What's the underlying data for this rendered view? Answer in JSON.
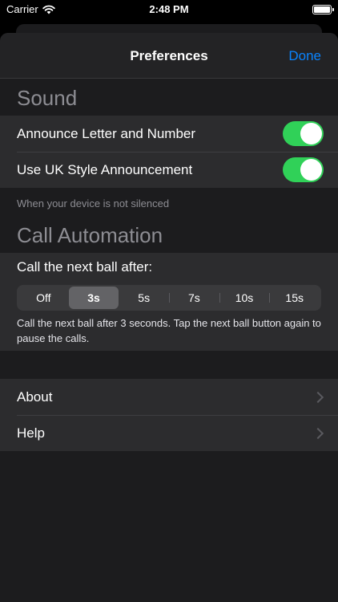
{
  "status_bar": {
    "carrier": "Carrier",
    "time": "2:48 PM",
    "battery_level": 1.0
  },
  "nav": {
    "title": "Preferences",
    "done_label": "Done"
  },
  "sound": {
    "header": "Sound",
    "rows": [
      {
        "label": "Announce Letter and Number",
        "on": true
      },
      {
        "label": "Use UK Style Announcement",
        "on": true
      }
    ],
    "footer": "When your device is not silenced"
  },
  "automation": {
    "header": "Call Automation",
    "label": "Call the next ball after:",
    "options": [
      "Off",
      "3s",
      "5s",
      "7s",
      "10s",
      "15s"
    ],
    "selected": "3s",
    "description": "Call the next ball after 3 seconds. Tap the next ball button again to pause the calls."
  },
  "links": [
    {
      "label": "About"
    },
    {
      "label": "Help"
    }
  ],
  "colors": {
    "accent": "#0a84ff",
    "toggle_on": "#30d158"
  }
}
